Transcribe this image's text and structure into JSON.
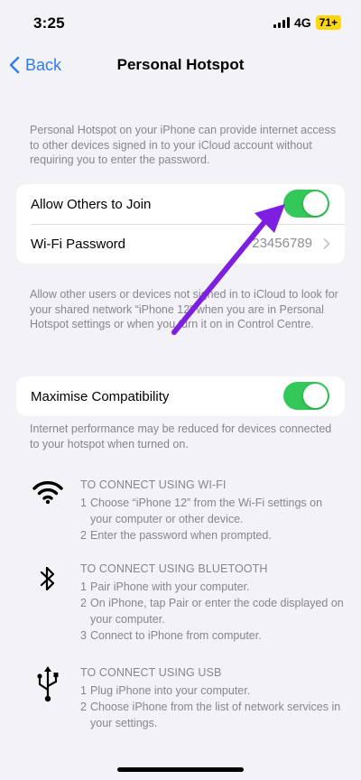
{
  "status_bar": {
    "time": "3:25",
    "network": "4G",
    "battery": "71+"
  },
  "nav": {
    "back_label": "Back",
    "title": "Personal Hotspot"
  },
  "intro_text": "Personal Hotspot on your iPhone can provide internet access to other devices signed in to your iCloud account without requiring you to enter the password.",
  "group1": {
    "allow_label": "Allow Others to Join",
    "allow_on": true,
    "password_label": "Wi-Fi Password",
    "password_value": "23456789"
  },
  "group1_footer": "Allow other users or devices not signed in to iCloud to look for your shared network “iPhone 12” when you are in Personal Hotspot settings or when you turn it on in Control Centre.",
  "group2": {
    "maximise_label": "Maximise Compatibility",
    "maximise_on": true
  },
  "group2_footer": "Internet performance may be reduced for devices connected to your hotspot when turned on.",
  "instructions": [
    {
      "icon": "wifi-icon",
      "title": "TO CONNECT USING WI-FI",
      "steps": [
        {
          "n": "1",
          "text": "Choose “iPhone 12” from the Wi-Fi settings on your computer or other device."
        },
        {
          "n": "2",
          "text": "Enter the password when prompted."
        }
      ]
    },
    {
      "icon": "bluetooth-icon",
      "title": "TO CONNECT USING BLUETOOTH",
      "steps": [
        {
          "n": "1",
          "text": "Pair iPhone with your computer."
        },
        {
          "n": "2",
          "text": "On iPhone, tap Pair or enter the code displayed on your computer."
        },
        {
          "n": "3",
          "text": "Connect to iPhone from computer."
        }
      ]
    },
    {
      "icon": "usb-icon",
      "title": "TO CONNECT USING USB",
      "steps": [
        {
          "n": "1",
          "text": "Plug iPhone into your computer."
        },
        {
          "n": "2",
          "text": "Choose iPhone from the list of network services in your settings."
        }
      ]
    }
  ],
  "colors": {
    "accent": "#2f7cf6",
    "toggle_on": "#34c759",
    "annotation_arrow": "#7d1ee0",
    "battery": "#ffd60a"
  }
}
